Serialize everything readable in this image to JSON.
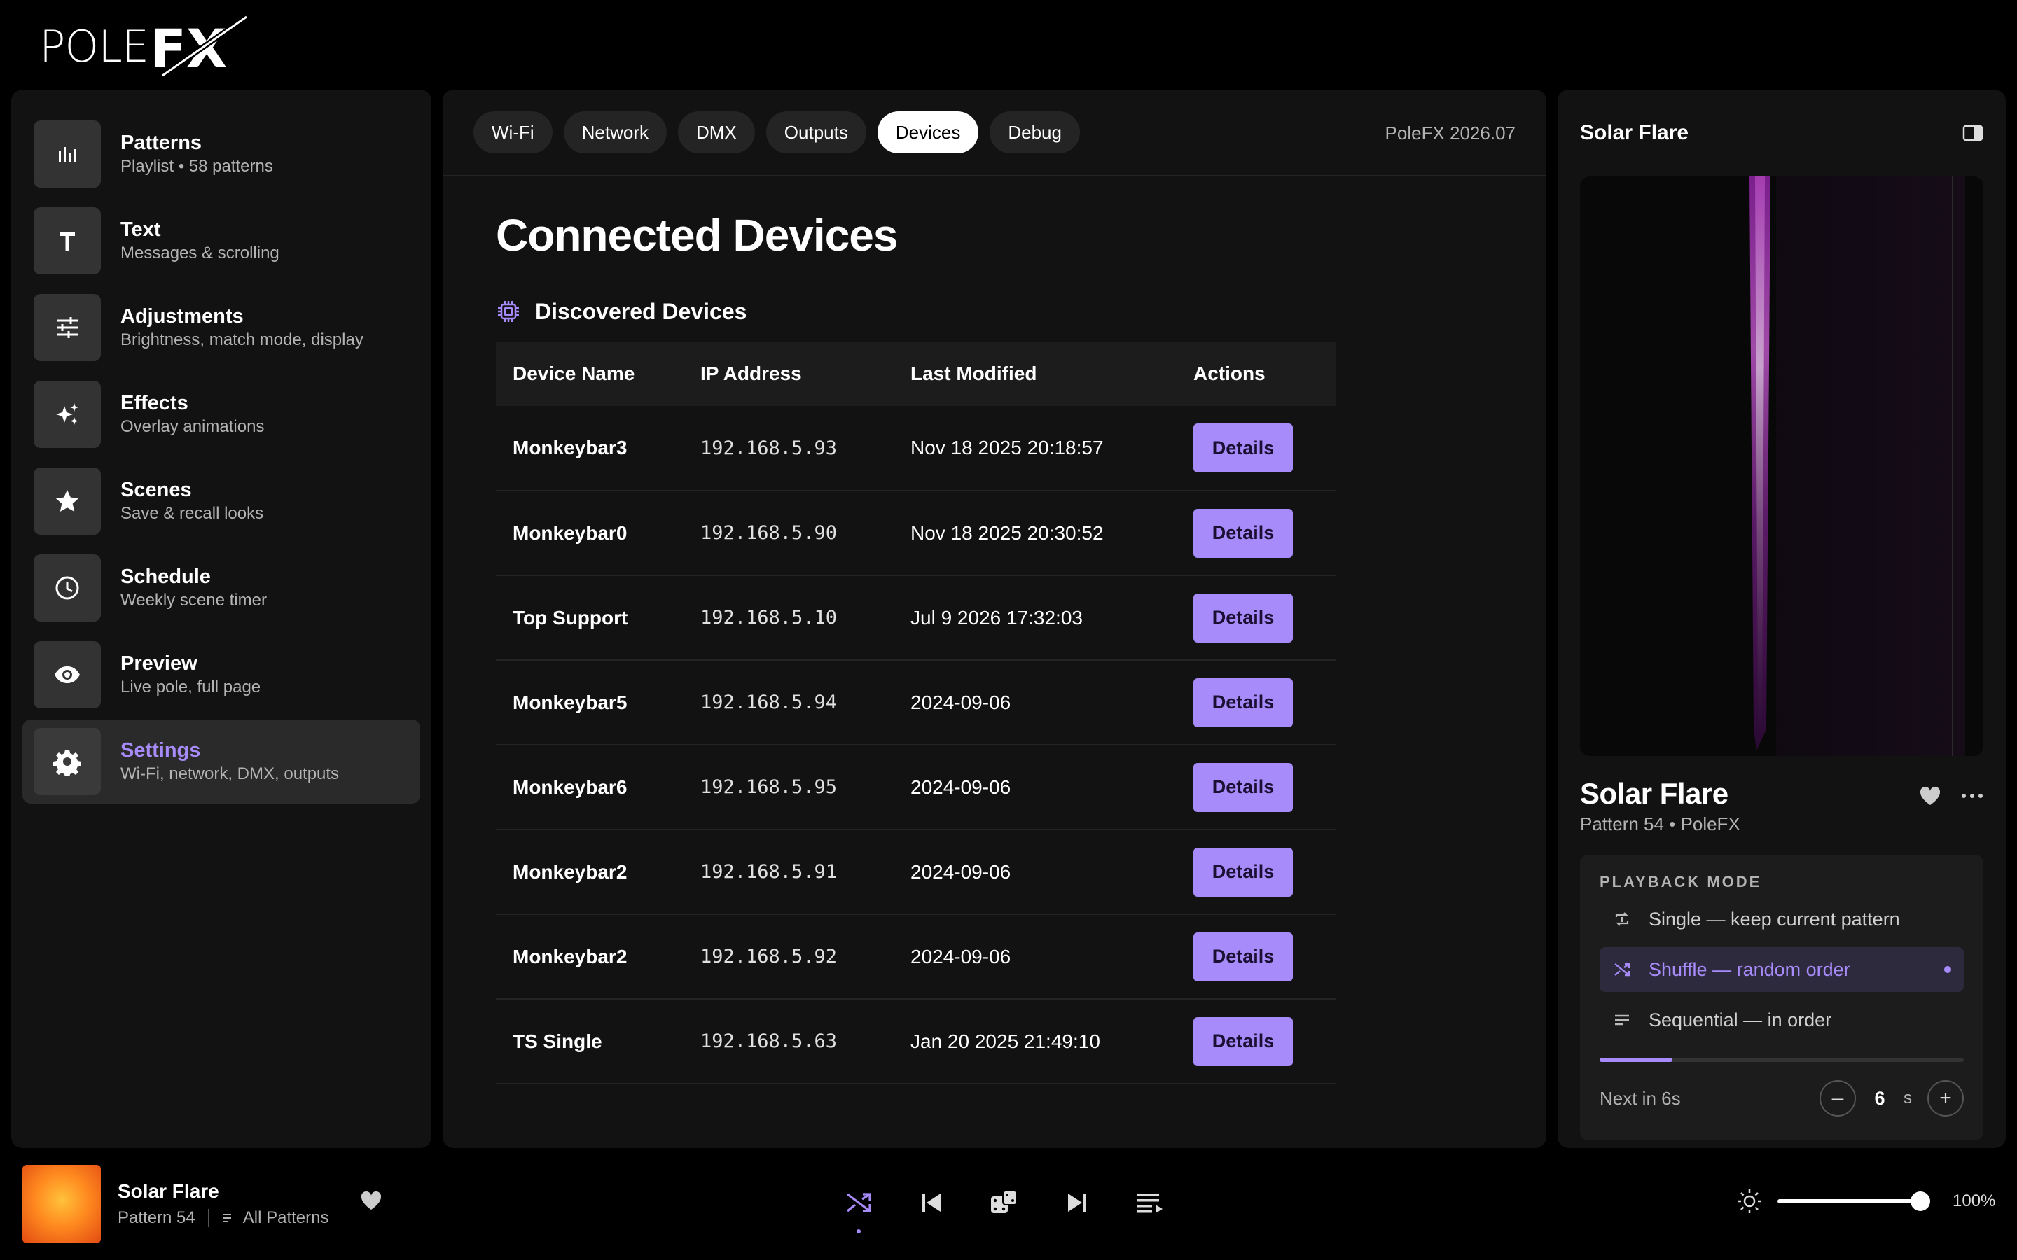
{
  "app": {
    "logo_text": "POLE",
    "logo_fx": "FX"
  },
  "sidebar": {
    "items": [
      {
        "title": "Patterns",
        "subtitle": "Playlist • 58 patterns",
        "icon": "bar-chart-icon"
      },
      {
        "title": "Text",
        "subtitle": "Messages & scrolling",
        "icon": "text-icon"
      },
      {
        "title": "Adjustments",
        "subtitle": "Brightness, match mode, display",
        "icon": "sliders-icon"
      },
      {
        "title": "Effects",
        "subtitle": "Overlay animations",
        "icon": "sparkles-icon"
      },
      {
        "title": "Scenes",
        "subtitle": "Save & recall looks",
        "icon": "star-icon"
      },
      {
        "title": "Schedule",
        "subtitle": "Weekly scene timer",
        "icon": "clock-icon"
      },
      {
        "title": "Preview",
        "subtitle": "Live pole, full page",
        "icon": "eye-icon"
      },
      {
        "title": "Settings",
        "subtitle": "Wi-Fi, network, DMX, outputs",
        "icon": "gear-icon",
        "active": true
      }
    ]
  },
  "tabs": [
    {
      "label": "Wi-Fi"
    },
    {
      "label": "Network"
    },
    {
      "label": "DMX"
    },
    {
      "label": "Outputs"
    },
    {
      "label": "Devices",
      "active": true
    },
    {
      "label": "Debug"
    }
  ],
  "version": "PoleFX 2026.07",
  "main": {
    "title": "Connected Devices",
    "section_title": "Discovered Devices",
    "columns": [
      "Device Name",
      "IP Address",
      "Last Modified",
      "Actions"
    ],
    "action_label": "Details",
    "devices": [
      {
        "name": "Monkeybar3",
        "ip": "192.168.5.93",
        "modified": "Nov 18 2025 20:18:57"
      },
      {
        "name": "Monkeybar0",
        "ip": "192.168.5.90",
        "modified": "Nov 18 2025 20:30:52"
      },
      {
        "name": "Top Support",
        "ip": "192.168.5.10",
        "modified": "Jul 9 2026 17:32:03"
      },
      {
        "name": "Monkeybar5",
        "ip": "192.168.5.94",
        "modified": "2024-09-06"
      },
      {
        "name": "Monkeybar6",
        "ip": "192.168.5.95",
        "modified": "2024-09-06"
      },
      {
        "name": "Monkeybar2",
        "ip": "192.168.5.91",
        "modified": "2024-09-06"
      },
      {
        "name": "Monkeybar2",
        "ip": "192.168.5.92",
        "modified": "2024-09-06"
      },
      {
        "name": "TS Single",
        "ip": "192.168.5.63",
        "modified": "Jan 20 2025 21:49:10"
      }
    ]
  },
  "right_panel": {
    "title": "Solar Flare",
    "pattern_name": "Solar Flare",
    "pattern_sub": "Pattern 54 • PoleFX",
    "playback": {
      "label": "PLAYBACK MODE",
      "options": [
        {
          "label": "Single — keep current pattern",
          "icon": "repeat-icon"
        },
        {
          "label": "Shuffle — random order",
          "icon": "shuffle-icon",
          "active": true
        },
        {
          "label": "Sequential — in order",
          "icon": "list-icon"
        }
      ],
      "progress": 0.2,
      "next_text": "Next in 6s",
      "interval_value": "6",
      "interval_unit": "s"
    }
  },
  "now_playing": {
    "title": "Solar Flare",
    "pattern": "Pattern 54",
    "playlist": "All Patterns"
  },
  "player": {
    "volume_pct": "100%",
    "volume": 1.0
  },
  "colors": {
    "accent": "#a78bfa",
    "panel": "#121212",
    "background": "#000000"
  }
}
